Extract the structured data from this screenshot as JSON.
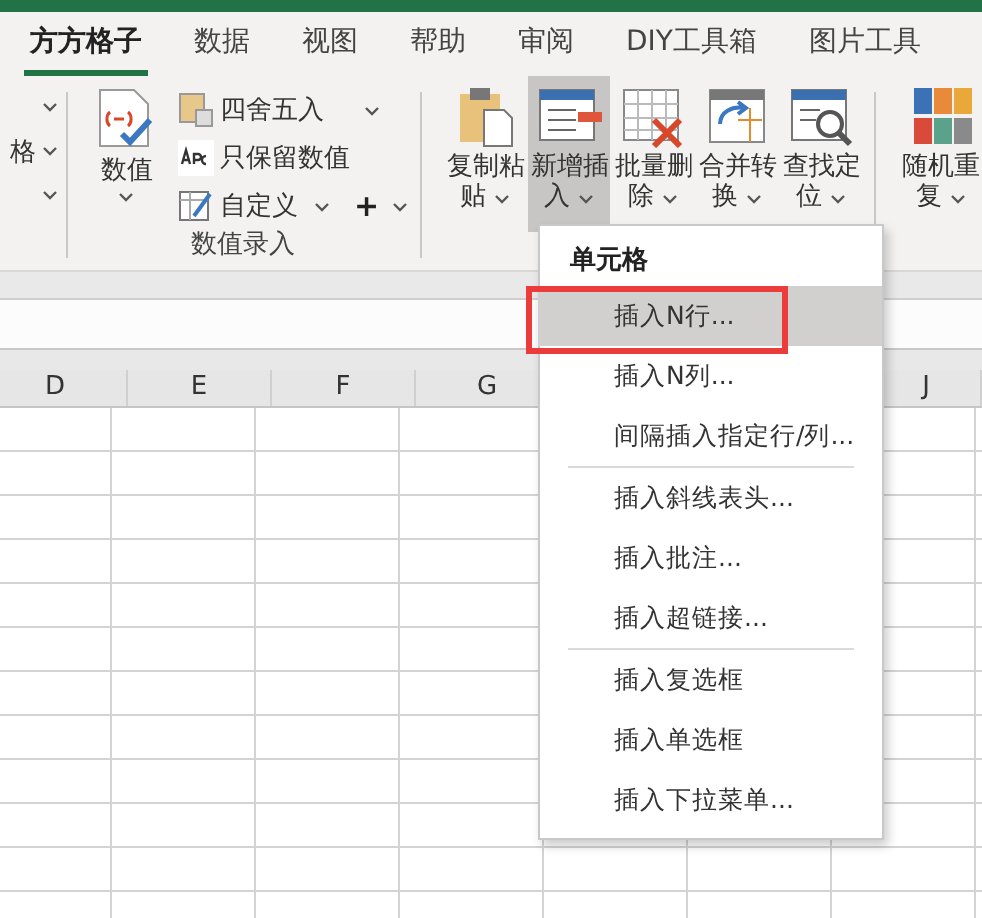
{
  "tabs": [
    {
      "label": "方方格子",
      "selected": true
    },
    {
      "label": "数据",
      "selected": false
    },
    {
      "label": "视图",
      "selected": false
    },
    {
      "label": "帮助",
      "selected": false
    },
    {
      "label": "审阅",
      "selected": false
    },
    {
      "label": "DIY工具箱",
      "selected": false
    },
    {
      "label": "图片工具",
      "selected": false
    }
  ],
  "left_group": {
    "items": [
      {
        "kind": "caret"
      },
      {
        "kind": "labeled",
        "label": "格"
      },
      {
        "kind": "caret"
      }
    ]
  },
  "number_group": {
    "big_button": {
      "label": "数值"
    },
    "small_buttons": [
      {
        "kind": "round",
        "label": "四舍五入",
        "dropdown": true
      },
      {
        "kind": "text",
        "label": "只保留数值",
        "dropdown": false
      },
      {
        "kind": "custom",
        "label": "自定义",
        "dropdown": true
      }
    ],
    "plus_button": {
      "label": "+"
    },
    "label": "数值录入"
  },
  "tool_buttons": [
    {
      "kind": "clipboard",
      "label": "复制粘贴",
      "selected": false
    },
    {
      "kind": "insert",
      "label": "新增插入",
      "selected": true
    },
    {
      "kind": "delete",
      "label": "批量删除",
      "selected": false
    },
    {
      "kind": "merge",
      "label": "合并转换",
      "selected": false
    },
    {
      "kind": "find",
      "label": "查找定位",
      "selected": false
    }
  ],
  "extra_buttons": [
    {
      "kind": "random",
      "label": "随机重复",
      "selected": false
    }
  ],
  "column_headers": [
    "D",
    "E",
    "F",
    "G",
    "J"
  ],
  "menu": {
    "title": "单元格",
    "sections": [
      [
        {
          "label": "插入N行...",
          "selected": true,
          "highlighted": true
        },
        {
          "label": "插入N列...",
          "selected": false,
          "highlighted": false
        },
        {
          "label": "间隔插入指定行/列...",
          "selected": false,
          "highlighted": false
        }
      ],
      [
        {
          "label": "插入斜线表头...",
          "selected": false,
          "highlighted": false
        },
        {
          "label": "插入批注...",
          "selected": false,
          "highlighted": false
        },
        {
          "label": "插入超链接...",
          "selected": false,
          "highlighted": false
        }
      ],
      [
        {
          "label": "插入复选框",
          "selected": false,
          "highlighted": false
        },
        {
          "label": "插入单选框",
          "selected": false,
          "highlighted": false
        },
        {
          "label": "插入下拉菜单...",
          "selected": false,
          "highlighted": false
        }
      ]
    ]
  }
}
